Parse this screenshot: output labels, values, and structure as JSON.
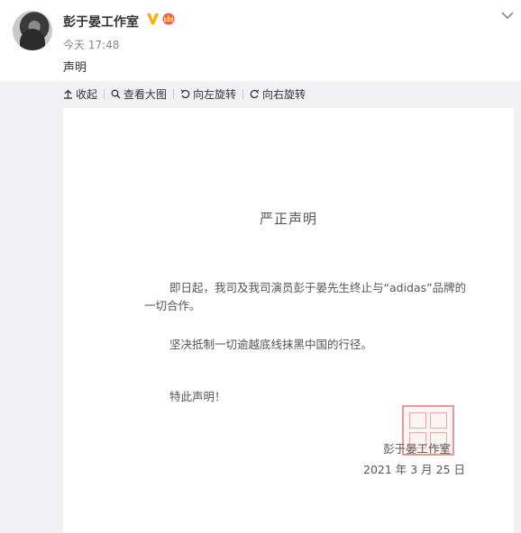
{
  "post": {
    "username": "彭于晏工作室",
    "timestamp": "今天 17:48",
    "text": "声明"
  },
  "toolbar": {
    "collapse": "收起",
    "view_large": "查看大图",
    "rotate_left": "向左旋转",
    "rotate_right": "向右旋转"
  },
  "document": {
    "title": "严正声明",
    "para1": "即日起，我司及我司演员彭于晏先生终止与“adidas”品牌的一切合作。",
    "para2": "坚决抵制一切逾越底线抹黑中国的行径。",
    "closing": "特此声明！",
    "signer": "彭于晏工作室",
    "date": "2021 年 3 月 25 日"
  },
  "icons": {
    "verify": "verified-v-icon",
    "crown": "vip-crown-icon",
    "chevron": "chevron-down-icon",
    "collapse": "arrow-up-icon",
    "view_large": "search-icon",
    "rotate_left": "rotate-left-icon",
    "rotate_right": "rotate-right-icon"
  },
  "colors": {
    "verify": "#f7b100",
    "crown": "#f25c5c",
    "seal": "#e39a9a"
  }
}
